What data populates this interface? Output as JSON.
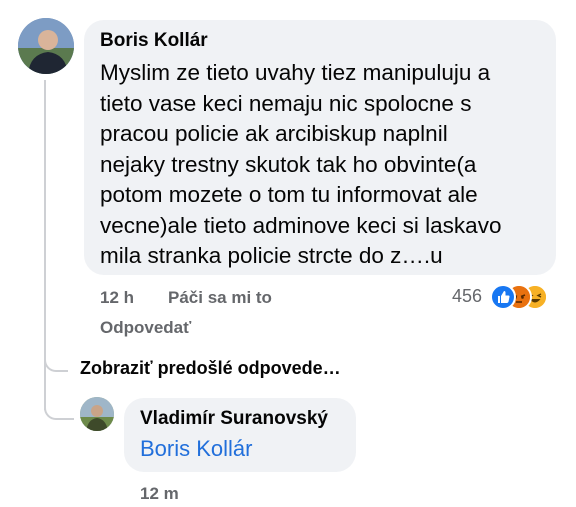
{
  "comment": {
    "author": "Boris Kollár",
    "text": "Myslim ze tieto uvahy tiez manipuluju a\ntieto vase keci nemaju nic spolocne s\npracou policie ak arcibiskup naplnil\nnejaky trestny skutok tak ho obvinte(a\npotom mozete o tom tu informovat ale\nvecne)ale tieto adminove keci si laskavo\nmila stranka policie strcte do z….u",
    "time": "12 h",
    "like_label": "Páči sa mi to",
    "reply_label": "Odpovedať",
    "reaction_count": "456",
    "reactions": [
      "like-icon",
      "angry-icon",
      "haha-icon"
    ]
  },
  "show_previous_replies": "Zobraziť predošlé odpovede…",
  "reply": {
    "author": "Vladimír Suranovský",
    "mention": "Boris Kollár",
    "time": "12 m"
  },
  "colors": {
    "bubble": "#f0f2f5",
    "mention": "#216fdb",
    "meta": "#65676b",
    "like": "#1877f2",
    "angry": "#e9710f",
    "haha": "#f7b125"
  }
}
